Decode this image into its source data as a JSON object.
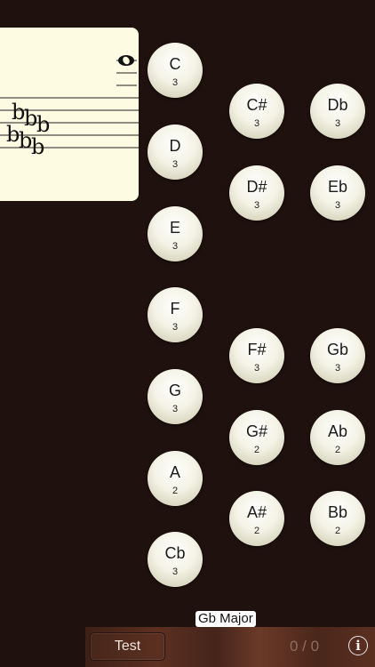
{
  "notes": [
    {
      "name": "C",
      "octave": "3"
    },
    {
      "name": "D",
      "octave": "3"
    },
    {
      "name": "E",
      "octave": "3"
    },
    {
      "name": "F",
      "octave": "3"
    },
    {
      "name": "G",
      "octave": "3"
    },
    {
      "name": "A",
      "octave": "2"
    },
    {
      "name": "Cb",
      "octave": "3"
    },
    {
      "name": "C#",
      "octave": "3"
    },
    {
      "name": "Db",
      "octave": "3"
    },
    {
      "name": "D#",
      "octave": "3"
    },
    {
      "name": "Eb",
      "octave": "3"
    },
    {
      "name": "F#",
      "octave": "3"
    },
    {
      "name": "Gb",
      "octave": "3"
    },
    {
      "name": "G#",
      "octave": "2"
    },
    {
      "name": "Ab",
      "octave": "2"
    },
    {
      "name": "A#",
      "octave": "2"
    },
    {
      "name": "Bb",
      "octave": "2"
    }
  ],
  "key_signature": {
    "label": "Gb Major",
    "flat_glyph": "b"
  },
  "toolbar": {
    "test_label": "Test",
    "score": "0 / 0",
    "info_glyph": "i"
  },
  "icons": {
    "info": "info-icon",
    "whole_note": "whole-note-icon"
  },
  "colors": {
    "background": "#1f110e",
    "staff_card": "#fdfbe2",
    "note_button": "#f4f3e6",
    "toolbar_wood": "#5c3021",
    "score_text": "#8f6d62"
  }
}
